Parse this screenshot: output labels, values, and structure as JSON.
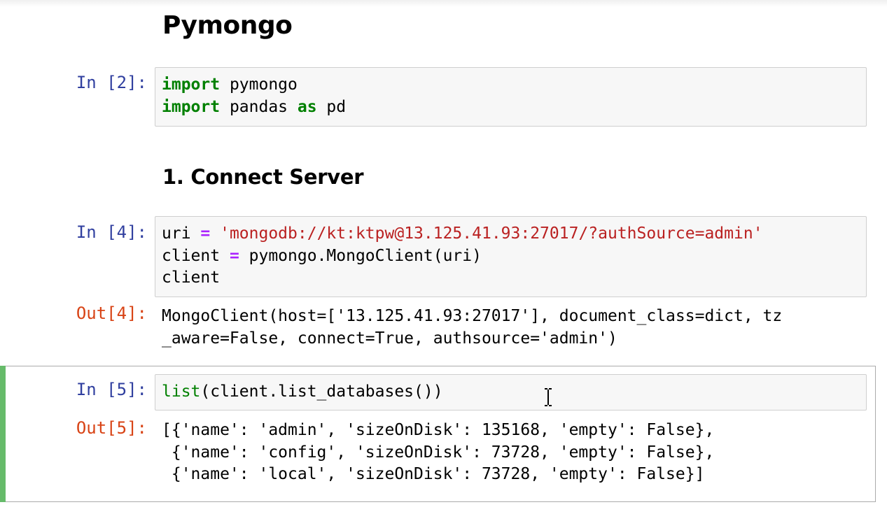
{
  "notebook": {
    "heading_1": "Pymongo",
    "heading_2": "1. Connect Server",
    "cells": [
      {
        "prompt": "In [2]:",
        "lines": [
          "import pymongo",
          "import pandas as pd"
        ]
      },
      {
        "prompt": "In [4]:",
        "lines": [
          "uri = 'mongodb://kt:ktpw@13.125.41.93:27017/?authSource=admin'",
          "client = pymongo.MongoClient(uri)",
          "client"
        ],
        "out_prompt": "Out[4]:",
        "output": [
          "MongoClient(host=['13.125.41.93:27017'], document_class=dict, tz",
          "_aware=False, connect=True, authsource='admin')"
        ]
      },
      {
        "prompt": "In [5]:",
        "lines": [
          "list(client.list_databases())"
        ],
        "out_prompt": "Out[5]:",
        "output": [
          "[{'name': 'admin', 'sizeOnDisk': 135168, 'empty': False},",
          " {'name': 'config', 'sizeOnDisk': 73728, 'empty': False},",
          " {'name': 'local', 'sizeOnDisk': 73728, 'empty': False}]"
        ]
      }
    ]
  },
  "tokens": {
    "c2_import": "import",
    "c2_pymongo": " pymongo",
    "c2_pandas": " pandas ",
    "c2_as": "as",
    "c2_pd": " pd",
    "c4_uri": "uri ",
    "c4_eq": "=",
    "c4_str": " 'mongodb://kt:ktpw@13.125.41.93:27017/?authSource=admin'",
    "c4_client_a": "client ",
    "c4_call": " pymongo.MongoClient(uri)",
    "c4_client_b": "client",
    "c5_list": "list",
    "c5_rest": "(client.list_databases())"
  },
  "colors": {
    "in_prompt": "#303f9f",
    "out_prompt": "#d84315",
    "keyword": "#008000",
    "string": "#ba2121",
    "operator": "#aa22ff",
    "selected_cell_bar": "#66bb6a",
    "code_background": "#f7f7f7"
  },
  "cursor": {
    "icon": "text-cursor-icon"
  }
}
